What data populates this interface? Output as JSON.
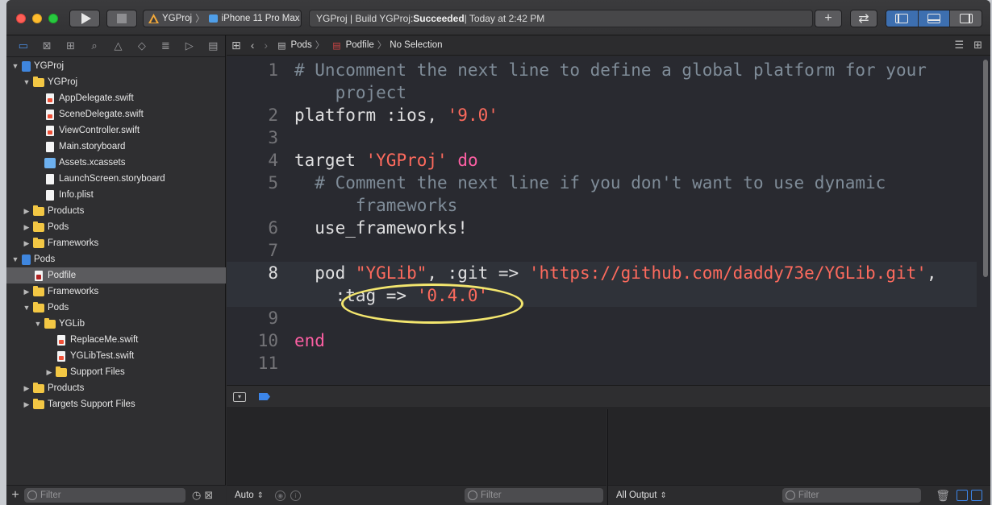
{
  "toolbar": {
    "scheme_project": "YGProj",
    "scheme_device": "iPhone 11 Pro Max",
    "activity_prefix": "YGProj | Build YGProj: ",
    "activity_status": "Succeeded",
    "activity_suffix": " | Today at 2:42 PM",
    "library_label": "+",
    "swap_label": "⇄"
  },
  "navigator": {
    "tabs": [
      "folder",
      "source-control",
      "symbols",
      "find",
      "issues",
      "tests",
      "debug",
      "breakpoints",
      "reports"
    ],
    "tree": [
      {
        "label": "YGProj",
        "depth": 0,
        "kind": "project",
        "open": true
      },
      {
        "label": "YGProj",
        "depth": 1,
        "kind": "folder",
        "open": true
      },
      {
        "label": "AppDelegate.swift",
        "depth": 2,
        "kind": "swift"
      },
      {
        "label": "SceneDelegate.swift",
        "depth": 2,
        "kind": "swift"
      },
      {
        "label": "ViewController.swift",
        "depth": 2,
        "kind": "swift"
      },
      {
        "label": "Main.storyboard",
        "depth": 2,
        "kind": "doc"
      },
      {
        "label": "Assets.xcassets",
        "depth": 2,
        "kind": "assets"
      },
      {
        "label": "LaunchScreen.storyboard",
        "depth": 2,
        "kind": "doc"
      },
      {
        "label": "Info.plist",
        "depth": 2,
        "kind": "doc"
      },
      {
        "label": "Products",
        "depth": 1,
        "kind": "folder",
        "open": false
      },
      {
        "label": "Pods",
        "depth": 1,
        "kind": "folder",
        "open": false
      },
      {
        "label": "Frameworks",
        "depth": 1,
        "kind": "folder",
        "open": false
      },
      {
        "label": "Pods",
        "depth": 0,
        "kind": "project",
        "open": true
      },
      {
        "label": "Podfile",
        "depth": 1,
        "kind": "ruby",
        "selected": true
      },
      {
        "label": "Frameworks",
        "depth": 1,
        "kind": "folder",
        "open": false
      },
      {
        "label": "Pods",
        "depth": 1,
        "kind": "folder",
        "open": true
      },
      {
        "label": "YGLib",
        "depth": 2,
        "kind": "folder",
        "open": true
      },
      {
        "label": "ReplaceMe.swift",
        "depth": 3,
        "kind": "swift"
      },
      {
        "label": "YGLibTest.swift",
        "depth": 3,
        "kind": "swift"
      },
      {
        "label": "Support Files",
        "depth": 3,
        "kind": "folder",
        "open": false
      },
      {
        "label": "Products",
        "depth": 1,
        "kind": "folder",
        "open": false
      },
      {
        "label": "Targets Support Files",
        "depth": 1,
        "kind": "folder",
        "open": false
      }
    ],
    "filter_placeholder": "Filter"
  },
  "jumpbar": {
    "crumbs": [
      "Pods",
      "Podfile",
      "No Selection"
    ]
  },
  "editor": {
    "lines": [
      {
        "n": "1",
        "parts": [
          {
            "t": "# Uncomment the next line to define a global platform for your",
            "c": "cmt"
          }
        ]
      },
      {
        "n": "",
        "parts": [
          {
            "t": "    project",
            "c": "cmt"
          }
        ]
      },
      {
        "n": "2",
        "parts": [
          {
            "t": "platform :ios, ",
            "c": ""
          },
          {
            "t": "'9.0'",
            "c": "str"
          }
        ]
      },
      {
        "n": "3",
        "parts": []
      },
      {
        "n": "4",
        "parts": [
          {
            "t": "target ",
            "c": ""
          },
          {
            "t": "'YGProj'",
            "c": "str"
          },
          {
            "t": " ",
            "c": ""
          },
          {
            "t": "do",
            "c": "kw"
          }
        ]
      },
      {
        "n": "5",
        "parts": [
          {
            "t": "  # Comment the next line if you don't want to use dynamic",
            "c": "cmt"
          }
        ]
      },
      {
        "n": "",
        "parts": [
          {
            "t": "      frameworks",
            "c": "cmt"
          }
        ]
      },
      {
        "n": "6",
        "parts": [
          {
            "t": "  use_frameworks!",
            "c": ""
          }
        ]
      },
      {
        "n": "7",
        "parts": []
      },
      {
        "n": "8",
        "cur": true,
        "parts": [
          {
            "t": "  pod ",
            "c": ""
          },
          {
            "t": "\"YGLib\"",
            "c": "str"
          },
          {
            "t": ", :git => ",
            "c": ""
          },
          {
            "t": "'https://github.com/daddy73e/YGLib.git'",
            "c": "str"
          },
          {
            "t": ",",
            "c": ""
          }
        ]
      },
      {
        "n": "",
        "cur": true,
        "parts": [
          {
            "t": "    :tag => ",
            "c": ""
          },
          {
            "t": "'0.4.0'",
            "c": "str"
          }
        ]
      },
      {
        "n": "9",
        "parts": []
      },
      {
        "n": "10",
        "parts": [
          {
            "t": "end",
            "c": "kw"
          }
        ]
      },
      {
        "n": "11",
        "parts": []
      }
    ]
  },
  "debug": {
    "variables_scope": "Auto",
    "variables_filter": "Filter",
    "console_mode": "All Output",
    "console_filter": "Filter"
  }
}
